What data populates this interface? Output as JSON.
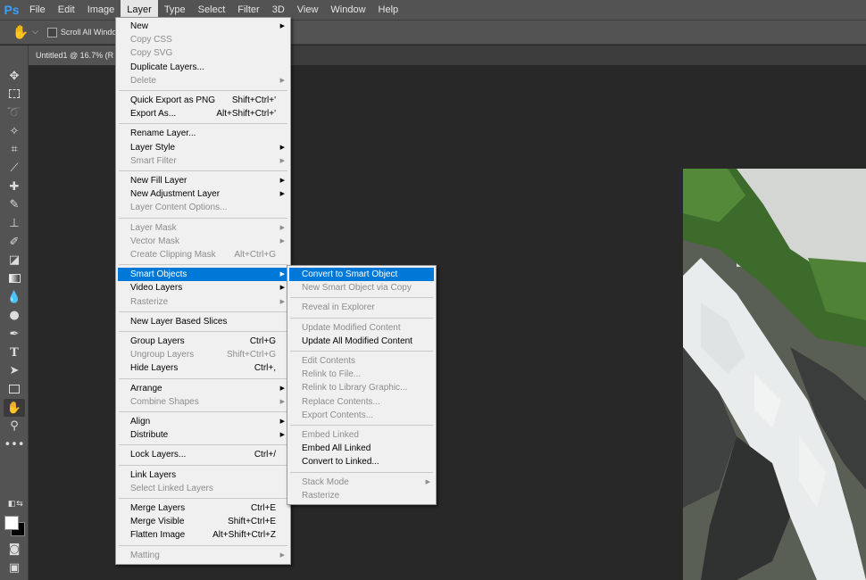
{
  "menubar": {
    "logo": "Ps",
    "items": [
      "File",
      "Edit",
      "Image",
      "Layer",
      "Type",
      "Select",
      "Filter",
      "3D",
      "View",
      "Window",
      "Help"
    ],
    "active": "Layer"
  },
  "options": {
    "tool_icon": "hand-icon",
    "scroll_all_windows": "Scroll All Window"
  },
  "document_tab": {
    "title": "Untitled1 @ 16.7% (R"
  },
  "colors": {
    "menu_highlight": "#0078d7",
    "ui_panel": "#535353",
    "canvas": "#282828",
    "logo": "#3aa0ff"
  },
  "tools": [
    "move-icon",
    "marquee-icon",
    "lasso-icon",
    "magic-wand-icon",
    "crop-icon",
    "eyedropper-icon",
    "healing-icon",
    "brush-icon",
    "stamp-icon",
    "history-brush-icon",
    "eraser-icon",
    "gradient-icon",
    "blur-icon",
    "dodge-icon",
    "pen-icon",
    "type-icon",
    "path-select-icon",
    "rectangle-icon",
    "hand-icon",
    "zoom-icon",
    "more-icon"
  ],
  "layer_menu": [
    {
      "label": "New",
      "shortcut": "",
      "sub": true,
      "disabled": false
    },
    {
      "label": "Copy CSS",
      "shortcut": "",
      "sub": false,
      "disabled": true
    },
    {
      "label": "Copy SVG",
      "shortcut": "",
      "sub": false,
      "disabled": true
    },
    {
      "label": "Duplicate Layers...",
      "shortcut": "",
      "sub": false,
      "disabled": false
    },
    {
      "label": "Delete",
      "shortcut": "",
      "sub": true,
      "disabled": true
    },
    {
      "sep": true
    },
    {
      "label": "Quick Export as PNG",
      "shortcut": "Shift+Ctrl+'",
      "sub": false,
      "disabled": false
    },
    {
      "label": "Export As...",
      "shortcut": "Alt+Shift+Ctrl+'",
      "sub": false,
      "disabled": false
    },
    {
      "sep": true
    },
    {
      "label": "Rename Layer...",
      "shortcut": "",
      "sub": false,
      "disabled": false
    },
    {
      "label": "Layer Style",
      "shortcut": "",
      "sub": true,
      "disabled": false
    },
    {
      "label": "Smart Filter",
      "shortcut": "",
      "sub": true,
      "disabled": true
    },
    {
      "sep": true
    },
    {
      "label": "New Fill Layer",
      "shortcut": "",
      "sub": true,
      "disabled": false
    },
    {
      "label": "New Adjustment Layer",
      "shortcut": "",
      "sub": true,
      "disabled": false
    },
    {
      "label": "Layer Content Options...",
      "shortcut": "",
      "sub": false,
      "disabled": true
    },
    {
      "sep": true
    },
    {
      "label": "Layer Mask",
      "shortcut": "",
      "sub": true,
      "disabled": true
    },
    {
      "label": "Vector Mask",
      "shortcut": "",
      "sub": true,
      "disabled": true
    },
    {
      "label": "Create Clipping Mask",
      "shortcut": "Alt+Ctrl+G",
      "sub": false,
      "disabled": true
    },
    {
      "sep": true
    },
    {
      "label": "Smart Objects",
      "shortcut": "",
      "sub": true,
      "disabled": false,
      "highlight": true
    },
    {
      "label": "Video Layers",
      "shortcut": "",
      "sub": true,
      "disabled": false
    },
    {
      "label": "Rasterize",
      "shortcut": "",
      "sub": true,
      "disabled": true
    },
    {
      "sep": true
    },
    {
      "label": "New Layer Based Slices",
      "shortcut": "",
      "sub": false,
      "disabled": false
    },
    {
      "sep": true
    },
    {
      "label": "Group Layers",
      "shortcut": "Ctrl+G",
      "sub": false,
      "disabled": false
    },
    {
      "label": "Ungroup Layers",
      "shortcut": "Shift+Ctrl+G",
      "sub": false,
      "disabled": true
    },
    {
      "label": "Hide Layers",
      "shortcut": "Ctrl+,",
      "sub": false,
      "disabled": false
    },
    {
      "sep": true
    },
    {
      "label": "Arrange",
      "shortcut": "",
      "sub": true,
      "disabled": false
    },
    {
      "label": "Combine Shapes",
      "shortcut": "",
      "sub": true,
      "disabled": true
    },
    {
      "sep": true
    },
    {
      "label": "Align",
      "shortcut": "",
      "sub": true,
      "disabled": false
    },
    {
      "label": "Distribute",
      "shortcut": "",
      "sub": true,
      "disabled": false
    },
    {
      "sep": true
    },
    {
      "label": "Lock Layers...",
      "shortcut": "Ctrl+/",
      "sub": false,
      "disabled": false
    },
    {
      "sep": true
    },
    {
      "label": "Link Layers",
      "shortcut": "",
      "sub": false,
      "disabled": false
    },
    {
      "label": "Select Linked Layers",
      "shortcut": "",
      "sub": false,
      "disabled": true
    },
    {
      "sep": true
    },
    {
      "label": "Merge Layers",
      "shortcut": "Ctrl+E",
      "sub": false,
      "disabled": false
    },
    {
      "label": "Merge Visible",
      "shortcut": "Shift+Ctrl+E",
      "sub": false,
      "disabled": false
    },
    {
      "label": "Flatten Image",
      "shortcut": "Alt+Shift+Ctrl+Z",
      "sub": false,
      "disabled": false
    },
    {
      "sep": true
    },
    {
      "label": "Matting",
      "shortcut": "",
      "sub": true,
      "disabled": true
    }
  ],
  "smart_objects_menu": [
    {
      "label": "Convert to Smart Object",
      "shortcut": "",
      "sub": false,
      "disabled": false,
      "highlight": true
    },
    {
      "label": "New Smart Object via Copy",
      "shortcut": "",
      "sub": false,
      "disabled": true
    },
    {
      "sep": true
    },
    {
      "label": "Reveal in Explorer",
      "shortcut": "",
      "sub": false,
      "disabled": true
    },
    {
      "sep": true
    },
    {
      "label": "Update Modified Content",
      "shortcut": "",
      "sub": false,
      "disabled": true
    },
    {
      "label": "Update All Modified Content",
      "shortcut": "",
      "sub": false,
      "disabled": false
    },
    {
      "sep": true
    },
    {
      "label": "Edit Contents",
      "shortcut": "",
      "sub": false,
      "disabled": true
    },
    {
      "label": "Relink to File...",
      "shortcut": "",
      "sub": false,
      "disabled": true
    },
    {
      "label": "Relink to Library Graphic...",
      "shortcut": "",
      "sub": false,
      "disabled": true
    },
    {
      "label": "Replace Contents...",
      "shortcut": "",
      "sub": false,
      "disabled": true
    },
    {
      "label": "Export Contents...",
      "shortcut": "",
      "sub": false,
      "disabled": true
    },
    {
      "sep": true
    },
    {
      "label": "Embed Linked",
      "shortcut": "",
      "sub": false,
      "disabled": true
    },
    {
      "label": "Embed All Linked",
      "shortcut": "",
      "sub": false,
      "disabled": false
    },
    {
      "label": "Convert to Linked...",
      "shortcut": "",
      "sub": false,
      "disabled": false
    },
    {
      "sep": true
    },
    {
      "label": "Stack Mode",
      "shortcut": "",
      "sub": true,
      "disabled": true
    },
    {
      "label": "Rasterize",
      "shortcut": "",
      "sub": false,
      "disabled": true
    }
  ]
}
